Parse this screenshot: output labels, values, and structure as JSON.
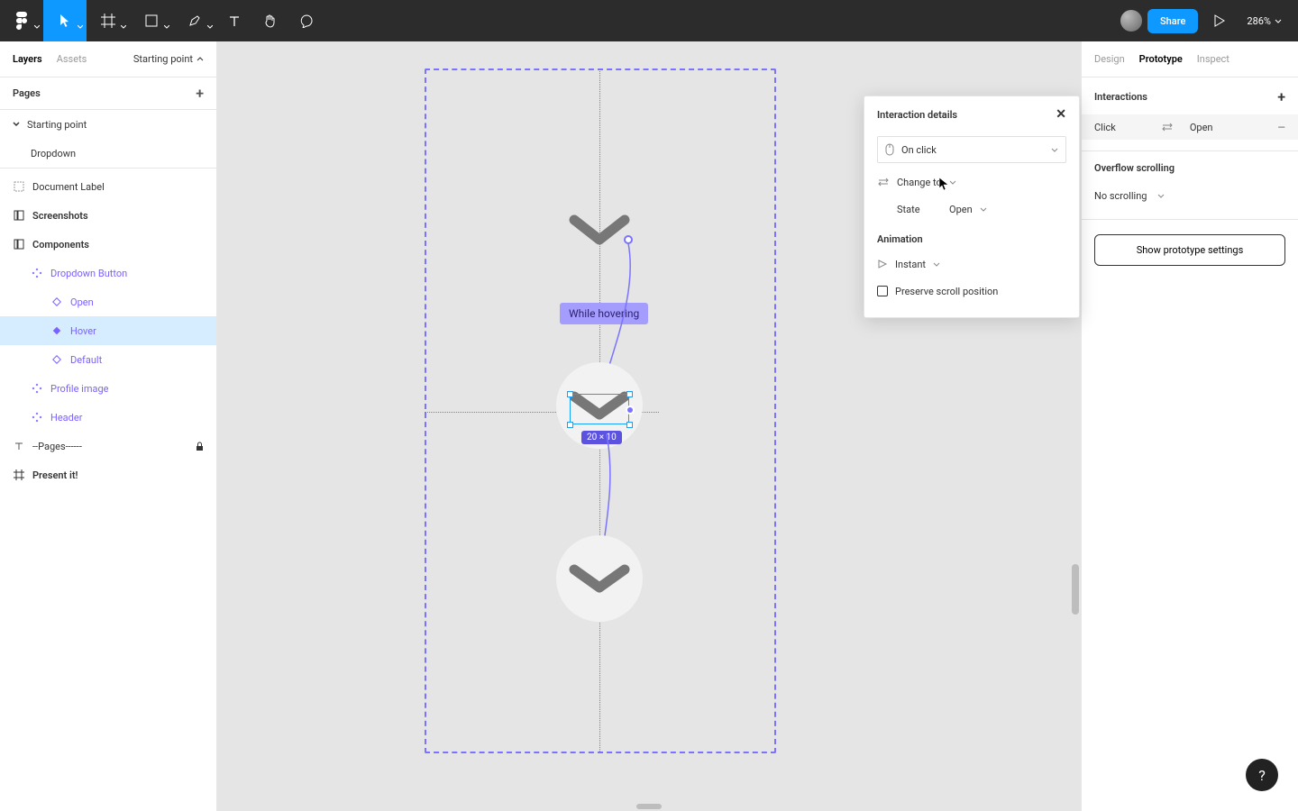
{
  "toolbar": {
    "share": "Share",
    "zoom": "286%"
  },
  "left": {
    "tabs": {
      "layers": "Layers",
      "assets": "Assets",
      "starting": "Starting point"
    },
    "pagesHeader": "Pages",
    "pages": [
      "Starting point",
      "Dropdown"
    ],
    "layers": [
      {
        "label": "Document Label",
        "icon": "dashed-rect",
        "depth": 0
      },
      {
        "label": "Screenshots",
        "icon": "frame-list",
        "depth": 0,
        "bold": true
      },
      {
        "label": "Components",
        "icon": "frame-list",
        "depth": 0,
        "bold": true,
        "expanded": true
      },
      {
        "label": "Dropdown Button",
        "icon": "diamond4",
        "depth": 1,
        "purple": true
      },
      {
        "label": "Open",
        "icon": "diamond",
        "depth": 2,
        "purple": true
      },
      {
        "label": "Hover",
        "icon": "diamond-fill",
        "depth": 2,
        "purple": true,
        "selected": true
      },
      {
        "label": "Default",
        "icon": "diamond",
        "depth": 2,
        "purple": true
      },
      {
        "label": "Profile image",
        "icon": "diamond4",
        "depth": 1,
        "purple": true
      },
      {
        "label": "Header",
        "icon": "diamond4",
        "depth": 1,
        "purple": true
      },
      {
        "label": "--Pages------",
        "icon": "text",
        "depth": 0,
        "locked": true
      },
      {
        "label": "Present it!",
        "icon": "hash",
        "depth": 0,
        "bold": true
      }
    ]
  },
  "right": {
    "tabs": {
      "design": "Design",
      "prototype": "Prototype",
      "inspect": "Inspect"
    },
    "interactionsHeader": "Interactions",
    "interactionRow": {
      "trigger": "Click",
      "action": "Open"
    },
    "overflowHeader": "Overflow scrolling",
    "overflowValue": "No scrolling",
    "showSettings": "Show prototype settings"
  },
  "popover": {
    "title": "Interaction details",
    "trigger": "On click",
    "action": "Change to",
    "stateLabel": "State",
    "stateValue": "Open",
    "animationHeader": "Animation",
    "animationValue": "Instant",
    "preserve": "Preserve scroll position"
  },
  "canvas": {
    "hoverLabel": "While hovering",
    "sizeBadge": "20 × 10"
  },
  "help": "?"
}
